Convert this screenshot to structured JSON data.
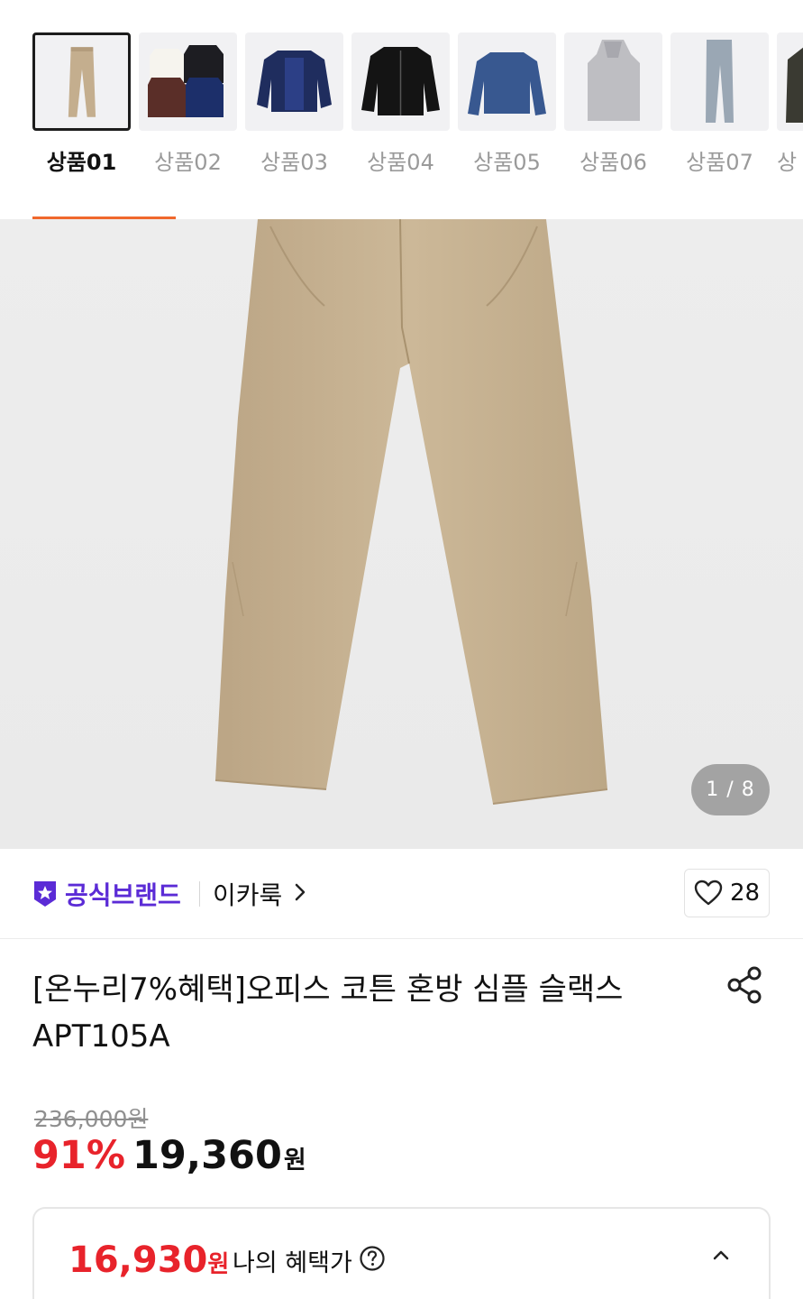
{
  "thumbnails": {
    "labels": [
      "상품01",
      "상품02",
      "상품03",
      "상품04",
      "상품05",
      "상품06",
      "상품07",
      "상"
    ],
    "selected_index": 0
  },
  "main_image": {
    "page_counter": "1 / 8"
  },
  "brand": {
    "official_label": "공식브랜드",
    "name": "이카룩"
  },
  "like": {
    "count": "28"
  },
  "product": {
    "title": "[온누리7%혜택]오피스 코튼 혼방 심플 슬랙스 APT105A"
  },
  "price": {
    "original": "236,000원",
    "discount": "91%",
    "sale": "19,360",
    "currency": "원"
  },
  "benefit": {
    "price": "16,930",
    "currency": "원",
    "label": "나의 혜택가"
  },
  "colors": {
    "accent": "#f0682d",
    "discount_red": "#e8232b",
    "brand_purple": "#5b2bd6"
  },
  "icons": [
    "brand-badge-icon",
    "chevron-right-icon",
    "heart-icon",
    "share-icon",
    "help-icon",
    "chevron-up-icon"
  ]
}
